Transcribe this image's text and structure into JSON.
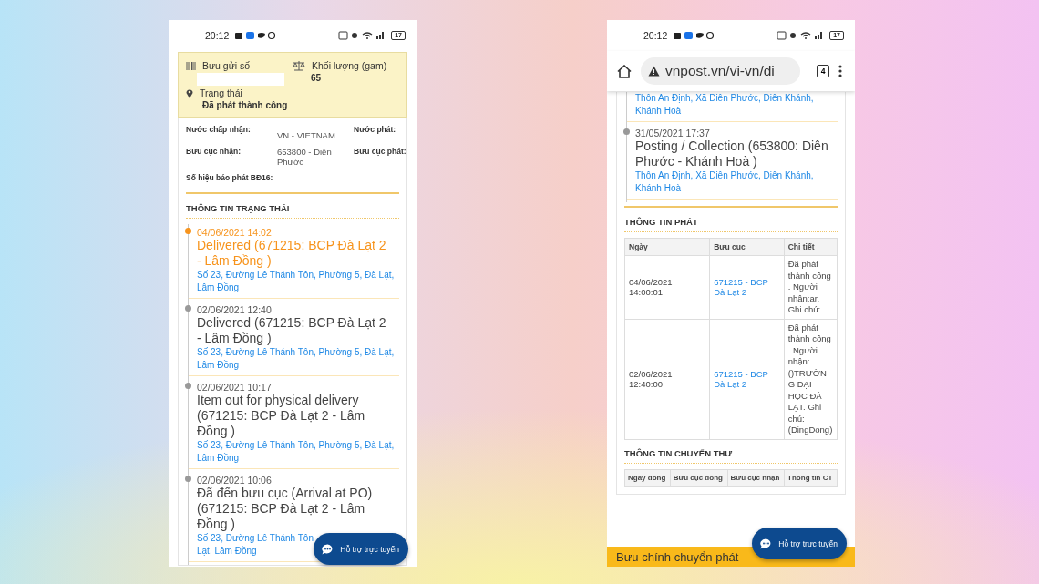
{
  "left_screen": {
    "status_bar": {
      "time": "20:12",
      "battery": "17"
    },
    "summary": {
      "parcel_label": "Bưu gửi số",
      "weight_label": "Khối lượng (gam)",
      "weight": "65",
      "status_label": "Trạng thái",
      "status": "Đã phát thành công"
    },
    "details": [
      {
        "label": "Nước chấp nhận:",
        "value": "VN - VIETNAM",
        "side_label": "Nước phát:"
      },
      {
        "label": "Bưu cục nhận:",
        "value": "653800 - Diên Phước",
        "side_label": "Bưu cục phát:"
      },
      {
        "label": "Số hiệu báo phát BĐ16:"
      }
    ],
    "status_section": {
      "title": "THÔNG TIN TRẠNG THÁI",
      "events": [
        {
          "time": "04/06/2021 14:02",
          "title": "Delivered (671215: BCP Đà Lạt 2 - Lâm Đồng )",
          "address": "Số 23, Đường Lê Thánh Tôn, Phường 5, Đà Lạt, Lâm Đồng",
          "current": true
        },
        {
          "time": "02/06/2021 12:40",
          "title": "Delivered (671215: BCP Đà Lạt 2 - Lâm Đồng )",
          "address": "Số 23, Đường Lê Thánh Tôn, Phường 5, Đà Lạt, Lâm Đồng",
          "current": false
        },
        {
          "time": "02/06/2021 10:17",
          "title": "Item out for physical delivery (671215: BCP Đà Lạt 2 - Lâm Đồng )",
          "address": "Số 23, Đường Lê Thánh Tôn, Phường 5, Đà Lạt, Lâm Đồng",
          "current": false
        },
        {
          "time": "02/06/2021 10:06",
          "title": "Đã đến bưu cục (Arrival at PO) (671215: BCP Đà Lạt 2 - Lâm Đồng )",
          "address": "Số 23, Đường Lê Thánh Tôn\nLạt, Lâm Đồng",
          "current": false
        }
      ]
    },
    "chat_button": "Hỗ trợ trực tuyến"
  },
  "right_screen": {
    "status_bar": {
      "time": "20:12",
      "battery": "17"
    },
    "browser": {
      "url": "vnpost.vn/vi-vn/di",
      "tab_count": "4"
    },
    "events": [
      {
        "address": "Thôn An Định, Xã Diên Phước, Diên Khánh, Khánh Hoà"
      },
      {
        "time": "31/05/2021 17:37",
        "title": "Posting / Collection (653800: Diên Phước - Khánh Hoà )",
        "address": "Thôn An Định, Xã Diên Phước, Diên Khánh, Khánh Hoà"
      }
    ],
    "delivery": {
      "title": "THÔNG TIN PHÁT",
      "columns": [
        "Ngày",
        "Bưu cục",
        "Chi tiết"
      ],
      "rows": [
        [
          "04/06/2021 14:00:01",
          "671215 - BCP Đà Lạt 2",
          "Đã phát thành công . Người nhận:ar. Ghi chú:"
        ],
        [
          "02/06/2021 12:40:00",
          "671215 - BCP Đà Lạt 2",
          "Đã phát thành công . Người nhận: ()TRƯỜNG ĐẠI HỌC ĐÀ LẠT. Ghi chú:(DingDong)"
        ]
      ]
    },
    "transfer": {
      "title": "THÔNG TIN CHUYẾN THƯ",
      "columns": [
        "Ngày đóng",
        "Bưu cục đóng",
        "Bưu cục nhận",
        "Thông tin CT"
      ]
    },
    "footer": "Bưu chính chuyển phát",
    "chat_button": "Hỗ trợ trực tuyến"
  }
}
